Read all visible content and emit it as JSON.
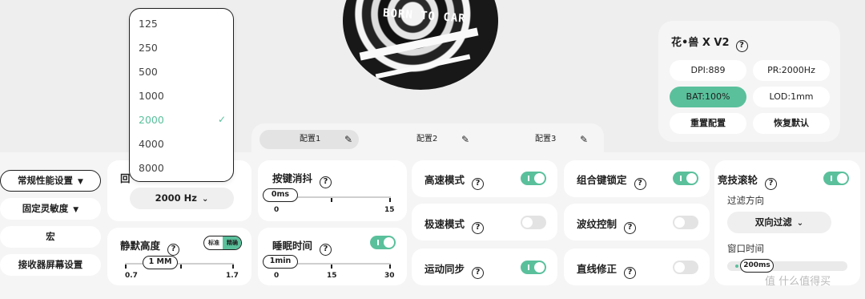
{
  "device": {
    "name": "花•兽 X V2",
    "dpi": "DPI:889",
    "pr": "PR:2000Hz",
    "bat": "BAT:100%",
    "lod": "LOD:1mm",
    "reset_config": "重置配置",
    "restore_default": "恢复默认"
  },
  "mouse_image": {
    "text": "BORN TO CAR"
  },
  "tabs": [
    {
      "label": "配置1",
      "selected": true
    },
    {
      "label": "配置2",
      "selected": false
    },
    {
      "label": "配置3",
      "selected": false
    }
  ],
  "sidebar": {
    "items": [
      {
        "label": "常规性能设置",
        "has_dropdown": true,
        "active": true
      },
      {
        "label": "固定灵敏度",
        "has_dropdown": true,
        "active": false
      },
      {
        "label": "宏",
        "has_dropdown": false,
        "active": false
      },
      {
        "label": "接收器屏幕设置",
        "has_dropdown": false,
        "active": false
      }
    ]
  },
  "polling": {
    "title_partial": "回",
    "value": "2000 Hz",
    "options": [
      "125",
      "250",
      "500",
      "1000",
      "2000",
      "4000",
      "8000"
    ],
    "selected": "2000"
  },
  "silent_height": {
    "title": "静默高度",
    "seg_left": "标准",
    "seg_right": "精确",
    "value": "1 MM",
    "min": "0.7",
    "max": "1.7",
    "level": 0.3
  },
  "debounce": {
    "title": "按键消抖",
    "value": "0ms",
    "min": "0",
    "max": "15",
    "level": 0.0
  },
  "sleep": {
    "title": "睡眠时间",
    "enabled": true,
    "value": "1min",
    "ticks": [
      "0",
      "15",
      "30"
    ],
    "level": 0.03
  },
  "toggles": {
    "high_speed": {
      "label": "高速模式",
      "on": true
    },
    "extreme_speed": {
      "label": "极速模式",
      "on": false
    },
    "motion_sync": {
      "label": "运动同步",
      "on": true
    },
    "combo_lock": {
      "label": "组合键锁定",
      "on": true
    },
    "ripple": {
      "label": "波纹控制",
      "on": false
    },
    "straight": {
      "label": "直线修正",
      "on": false
    }
  },
  "wheel": {
    "title": "竞技滚轮",
    "enabled": true,
    "filter_label": "过滤方向",
    "filter_value": "双向过滤",
    "window_label": "窗口时间",
    "window_value": "200ms",
    "level": 0.2
  },
  "watermark": "值 什么值得买",
  "colors": {
    "accent": "#5ac09c",
    "panel": "#f5f5f5",
    "card": "#ffffff"
  }
}
